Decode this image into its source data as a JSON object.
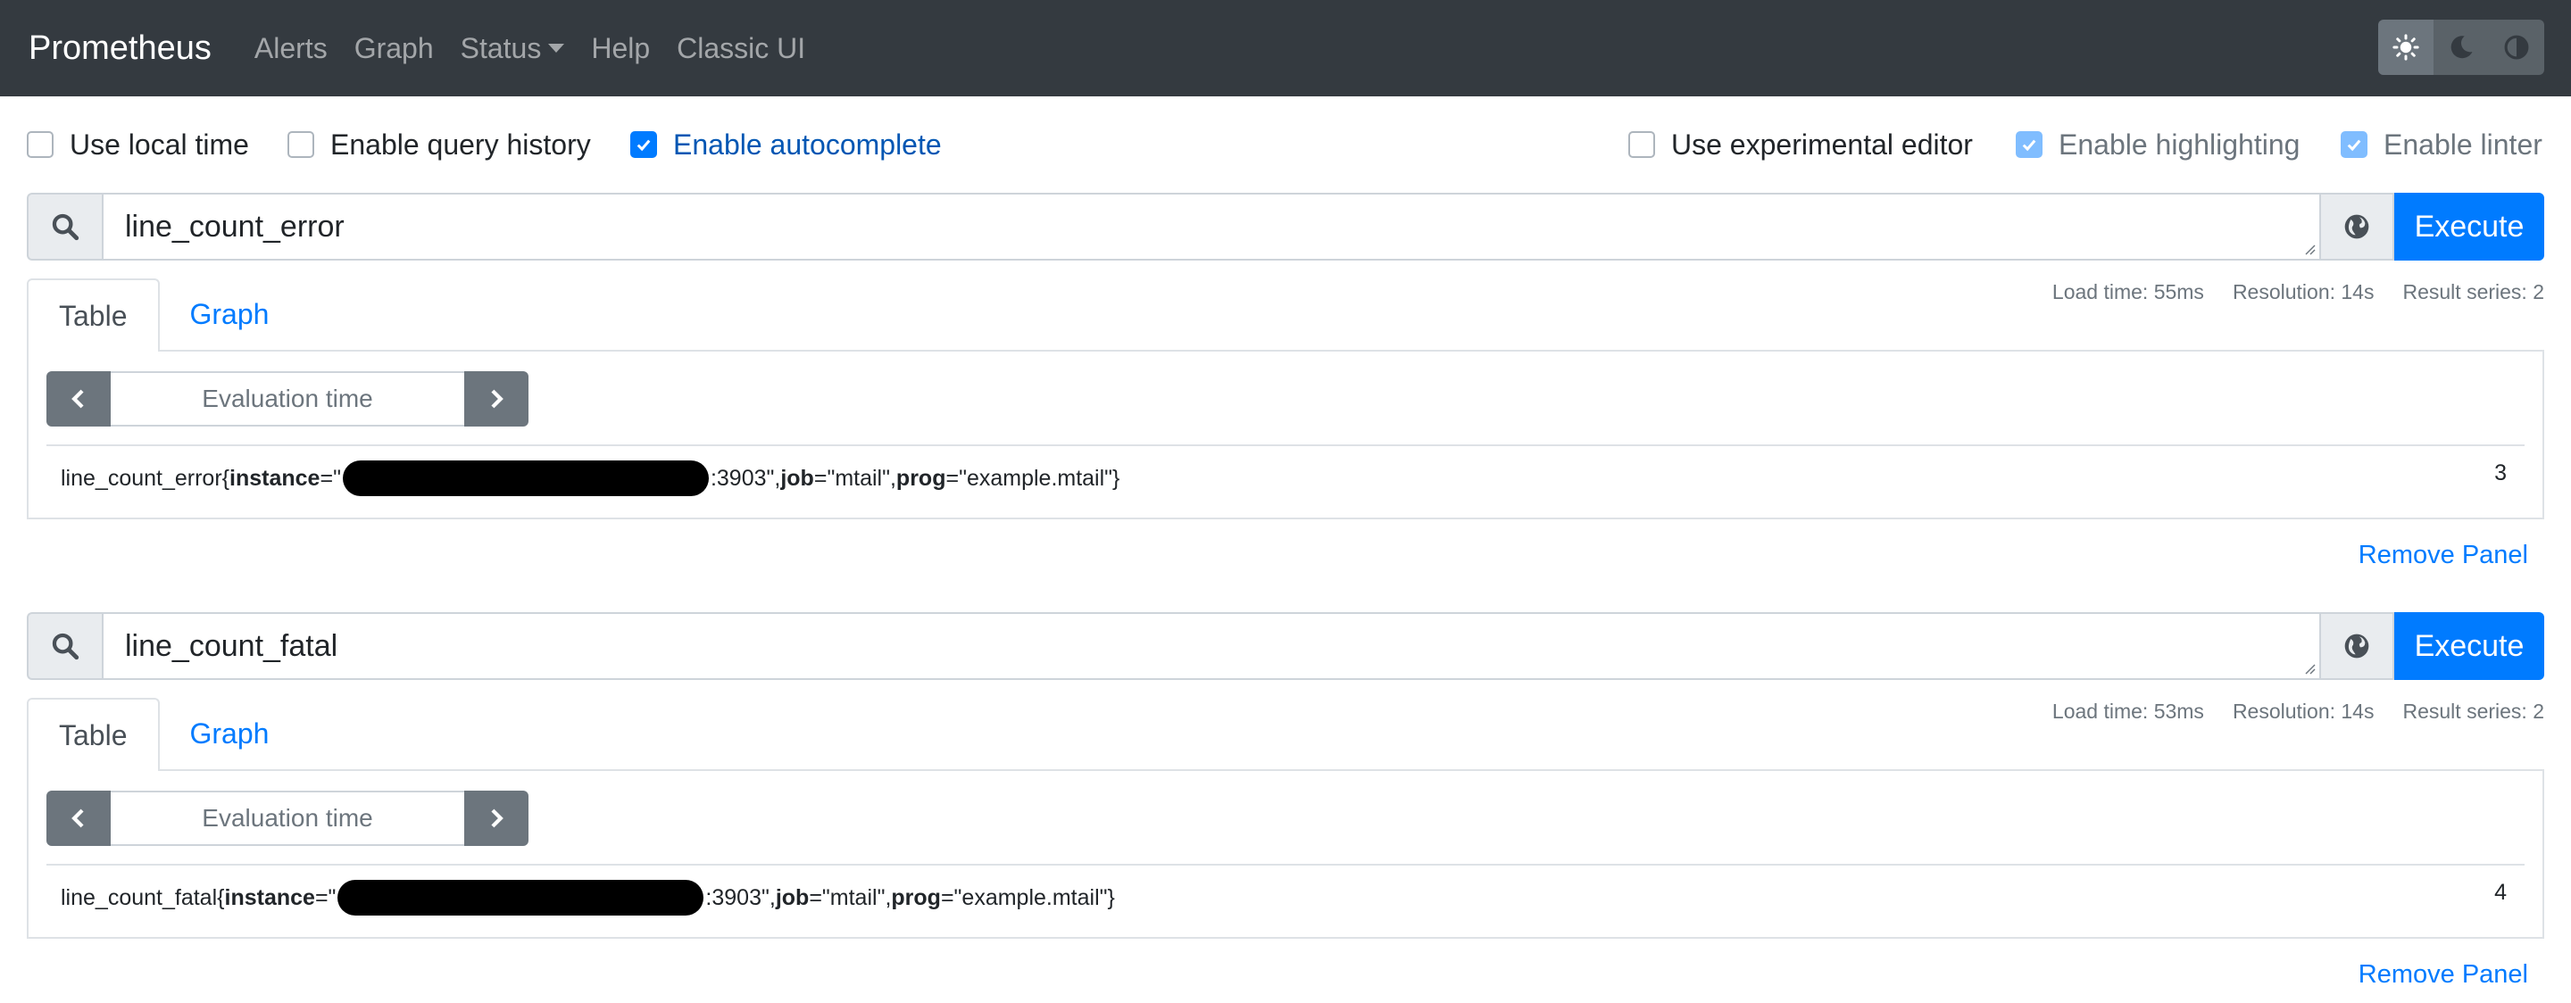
{
  "navbar": {
    "brand": "Prometheus",
    "links": [
      "Alerts",
      "Graph",
      "Status",
      "Help",
      "Classic UI"
    ],
    "theme_icons": [
      "sun-icon",
      "moon-icon",
      "contrast-icon"
    ]
  },
  "options": {
    "use_local_time": {
      "label": "Use local time",
      "checked": false
    },
    "enable_query_history": {
      "label": "Enable query history",
      "checked": false
    },
    "enable_autocomplete": {
      "label": "Enable autocomplete",
      "checked": true
    },
    "use_experimental_editor": {
      "label": "Use experimental editor",
      "checked": false
    },
    "enable_highlighting": {
      "label": "Enable highlighting",
      "checked": true
    },
    "enable_linter": {
      "label": "Enable linter",
      "checked": true
    }
  },
  "panels": [
    {
      "query": "line_count_error",
      "execute_label": "Execute",
      "stats": {
        "load_time": "Load time: 55ms",
        "resolution": "Resolution: 14s",
        "result_series": "Result series: 2"
      },
      "tabs": {
        "table": "Table",
        "graph": "Graph"
      },
      "eval_placeholder": "Evaluation time",
      "result": {
        "metric": "line_count_error",
        "open_brace": "{",
        "instance_label": "instance",
        "eq_quote": "=\"",
        "port_suffix": ":3903\", ",
        "job_label": "job",
        "job_value": "=\"mtail\", ",
        "prog_label": "prog",
        "prog_value": "=\"example.mtail\"}",
        "value": "3"
      },
      "remove_label": "Remove Panel"
    },
    {
      "query": "line_count_fatal",
      "execute_label": "Execute",
      "stats": {
        "load_time": "Load time: 53ms",
        "resolution": "Resolution: 14s",
        "result_series": "Result series: 2"
      },
      "tabs": {
        "table": "Table",
        "graph": "Graph"
      },
      "eval_placeholder": "Evaluation time",
      "result": {
        "metric": "line_count_fatal",
        "open_brace": "{",
        "instance_label": "instance",
        "eq_quote": "=\"",
        "port_suffix": ":3903\", ",
        "job_label": "job",
        "job_value": "=\"mtail\", ",
        "prog_label": "prog",
        "prog_value": "=\"example.mtail\"}",
        "value": "4"
      },
      "remove_label": "Remove Panel"
    }
  ],
  "colors": {
    "navbar": "#343a40",
    "primary": "#007bff",
    "border": "#dee2e6"
  }
}
